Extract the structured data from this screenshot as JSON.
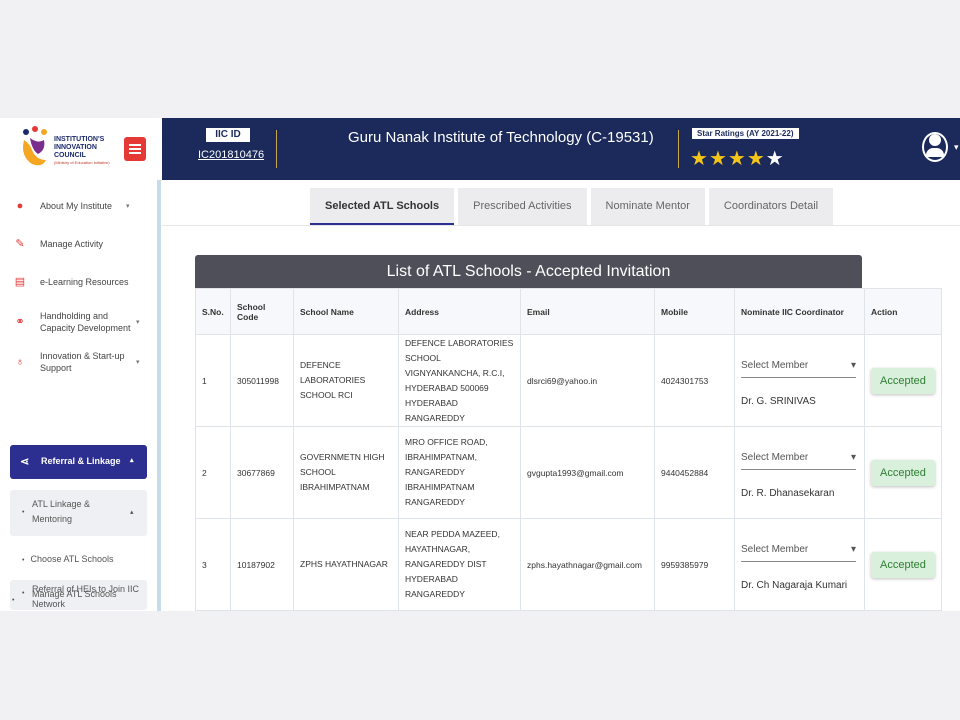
{
  "logo": {
    "line1": "INSTITUTION'S",
    "line2": "INNOVATION",
    "line3": "COUNCIL",
    "tagline": "(Ministry of Education Initiative)"
  },
  "header": {
    "iic_id_label": "IIC ID",
    "iic_id_value": "IC201810476",
    "institute_name": "Guru Nanak Institute of Technology (C-19531)",
    "star_label": "Star Ratings (AY 2021-22)",
    "stars_filled": 4,
    "stars_total": 5
  },
  "sidebar": {
    "items": [
      {
        "label": "About My Institute",
        "icon": "person-icon"
      },
      {
        "label": "Manage Activity",
        "icon": "edit-icon"
      },
      {
        "label": "e-Learning Resources",
        "icon": "book-icon"
      },
      {
        "label": "Handholding and Capacity Development",
        "icon": "handshake-icon"
      },
      {
        "label": "Innovation & Start-up Support",
        "icon": "bulb-icon"
      }
    ],
    "active": "Referral & Linkage",
    "submenu": "ATL Linkage & Mentoring",
    "links": [
      "Choose ATL Schools",
      "Manage ATL Schools"
    ],
    "last": "Referral of HEIs to Join IIC Network"
  },
  "tabs": [
    "Selected ATL Schools",
    "Prescribed Activities",
    "Nominate Mentor",
    "Coordinators Detail"
  ],
  "list": {
    "title": "List of ATL Schools - Accepted Invitation",
    "columns": [
      "S.No.",
      "School Code",
      "School Name",
      "Address",
      "Email",
      "Mobile",
      "Nominate IIC Coordinator",
      "Action"
    ],
    "select_placeholder": "Select Member",
    "rows": [
      {
        "sno": "1",
        "code": "305011998",
        "name": "DEFENCE LABORATORIES SCHOOL RCI",
        "address": "DEFENCE LABORATORIES SCHOOL VIGNYANKANCHA, R.C.I, HYDERABAD 500069 HYDERABAD RANGAREDDY",
        "email": "dlsrci69@yahoo.in",
        "mobile": "4024301753",
        "coordinator": "Dr. G. SRINIVAS",
        "action": "Accepted"
      },
      {
        "sno": "2",
        "code": "30677869",
        "name": "GOVERNMETN HIGH SCHOOL IBRAHIMPATNAM",
        "address": "MRO OFFICE ROAD, IBRAHIMPATNAM, RANGAREDDY IBRAHIMPATNAM RANGAREDDY",
        "email": "gvgupta1993@gmail.com",
        "mobile": "9440452884",
        "coordinator": "Dr. R. Dhanasekaran",
        "action": "Accepted"
      },
      {
        "sno": "3",
        "code": "10187902",
        "name": "ZPHS HAYATHNAGAR",
        "address": "NEAR PEDDA MAZEED, HAYATHNAGAR, RANGAREDDY DIST HYDERABAD RANGAREDDY",
        "email": "zphs.hayathnagar@gmail.com",
        "mobile": "9959385979",
        "coordinator": "Dr. Ch Nagaraja Kumari",
        "action": "Accepted"
      }
    ]
  }
}
